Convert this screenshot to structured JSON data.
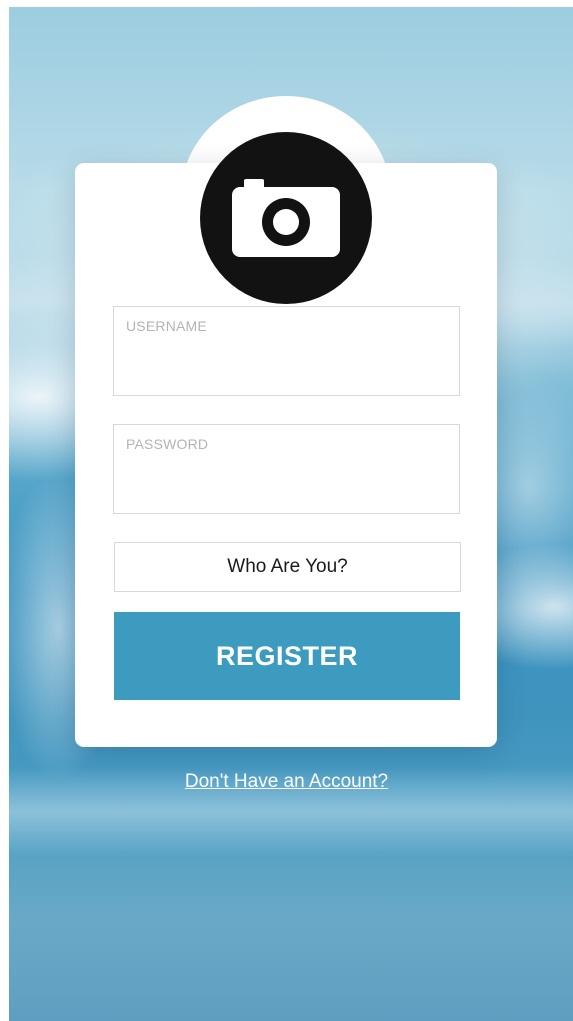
{
  "login_form": {
    "icon": "camera-icon",
    "username_placeholder": "USERNAME",
    "password_placeholder": "PASSWORD",
    "role_select_label": "Who Are You?",
    "register_label": "REGISTER"
  },
  "footer": {
    "link_text": "Don't Have an Account?"
  },
  "colors": {
    "accent": "#3c9bbe",
    "avatar_bg": "#121212",
    "card_bg": "#ffffff"
  }
}
